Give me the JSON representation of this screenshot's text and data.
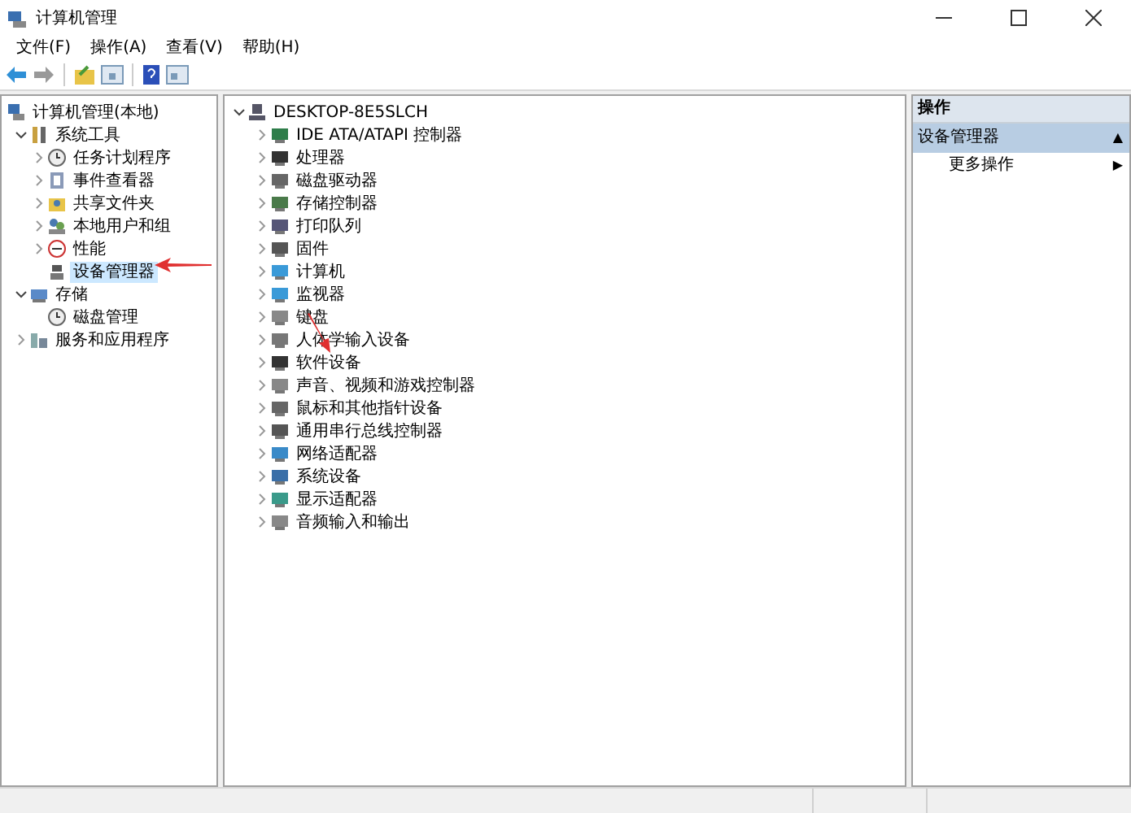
{
  "window": {
    "title": "计算机管理"
  },
  "menu": [
    "文件(F)",
    "操作(A)",
    "查看(V)",
    "帮助(H)"
  ],
  "tree": [
    {
      "label": "计算机管理(本地)",
      "selected": false,
      "children": [
        {
          "label": "系统工具",
          "expanded": true,
          "selected": false,
          "children": [
            {
              "label": "任务计划程序",
              "expanded": false,
              "selected": false
            },
            {
              "label": "事件查看器",
              "expanded": false,
              "selected": false
            },
            {
              "label": "共享文件夹",
              "expanded": false,
              "selected": false
            },
            {
              "label": "本地用户和组",
              "expanded": false,
              "selected": false
            },
            {
              "label": "性能",
              "expanded": false,
              "selected": false
            },
            {
              "label": "设备管理器",
              "selected": true
            }
          ]
        },
        {
          "label": "存储",
          "expanded": true,
          "selected": false,
          "children": [
            {
              "label": "磁盘管理",
              "selected": false
            }
          ]
        },
        {
          "label": "服务和应用程序",
          "expanded": false,
          "selected": false
        }
      ]
    }
  ],
  "devices": {
    "computer": "DESKTOP-8E5SLCH",
    "expanded": true,
    "categories": [
      {
        "label": "IDE ATA/ATAPI 控制器",
        "expanded": false
      },
      {
        "label": "处理器",
        "expanded": false
      },
      {
        "label": "磁盘驱动器",
        "expanded": false
      },
      {
        "label": "存储控制器",
        "expanded": false
      },
      {
        "label": "打印队列",
        "expanded": false
      },
      {
        "label": "固件",
        "expanded": false
      },
      {
        "label": "计算机",
        "expanded": false
      },
      {
        "label": "监视器",
        "expanded": false
      },
      {
        "label": "键盘",
        "expanded": false
      },
      {
        "label": "人体学输入设备",
        "expanded": false
      },
      {
        "label": "软件设备",
        "expanded": false
      },
      {
        "label": "声音、视频和游戏控制器",
        "expanded": false
      },
      {
        "label": "鼠标和其他指针设备",
        "expanded": false
      },
      {
        "label": "通用串行总线控制器",
        "expanded": false
      },
      {
        "label": "网络适配器",
        "expanded": false
      },
      {
        "label": "系统设备",
        "expanded": false
      },
      {
        "label": "显示适配器",
        "expanded": false
      },
      {
        "label": "音频输入和输出",
        "expanded": false
      }
    ]
  },
  "actions": {
    "header": "操作",
    "section": {
      "label": "设备管理器",
      "toggle": "▲",
      "expanded": true
    },
    "items": [
      {
        "label": "更多操作",
        "arrow": "▶"
      }
    ]
  }
}
